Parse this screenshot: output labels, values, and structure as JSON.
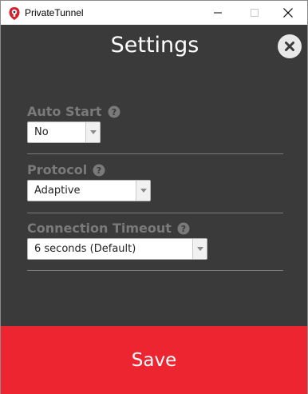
{
  "window": {
    "title": "PrivateTunnel",
    "minimize_glyph": "minimize-icon",
    "maximize_glyph": "maximize-icon",
    "close_glyph": "close-icon"
  },
  "header": {
    "title": "Settings",
    "close_icon": "close-icon"
  },
  "settings": {
    "auto_start": {
      "label": "Auto Start",
      "value": "No"
    },
    "protocol": {
      "label": "Protocol",
      "value": "Adaptive"
    },
    "timeout": {
      "label": "Connection Timeout",
      "value": "6 seconds (Default)"
    }
  },
  "footer": {
    "save_label": "Save"
  },
  "colors": {
    "background": "#3a3a3a",
    "label": "#7a7a7a",
    "accent": "#ec2530"
  }
}
